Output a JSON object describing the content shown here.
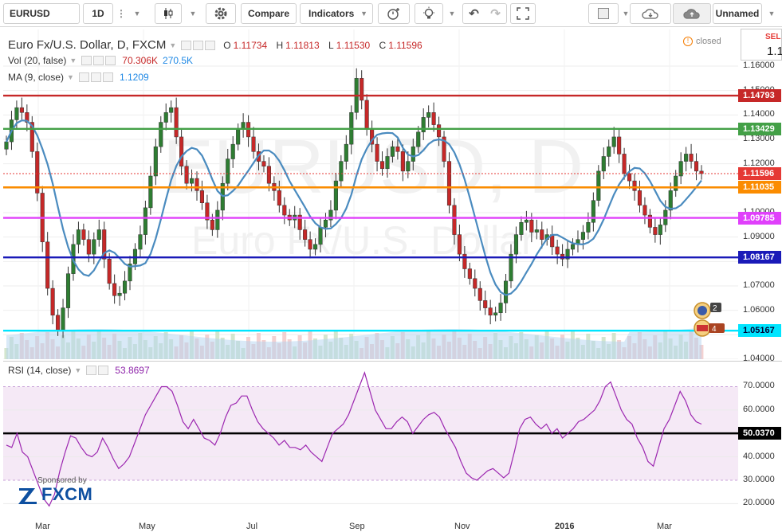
{
  "toolbar": {
    "symbol": "EURUSD",
    "interval": "1D",
    "compare": "Compare",
    "indicators": "Indicators",
    "layout_name": "Unnamed"
  },
  "main_legend": {
    "title": "Euro Fx/U.S. Dollar, D, FXCM",
    "o_label": "O",
    "o": "1.11734",
    "h_label": "H",
    "h": "1.11813",
    "l_label": "L",
    "l": "1.11530",
    "c_label": "C",
    "c": "1.11596",
    "vol_label": "Vol (20, false)",
    "vol_v1": "70.306K",
    "vol_v2": "270.5K",
    "ma_label": "MA (9, close)",
    "ma_v": "1.1209"
  },
  "status": {
    "closed": "closed"
  },
  "sell_panel": {
    "label": "SEL",
    "price": "1.1"
  },
  "watermark": {
    "line1": "EURUSD, D",
    "line2": "Euro Fx/U.S. Dollar"
  },
  "price_axis": {
    "ticks": [
      "1.15000",
      "1.16000",
      "1.14000",
      "1.13000",
      "1.12000",
      "1.10000",
      "1.09000",
      "1.08000",
      "1.07000",
      "1.06000",
      "1.04000"
    ],
    "levels": [
      {
        "label": "1.14793",
        "value": 1.14793,
        "color": "#c62828"
      },
      {
        "label": "1.13429",
        "value": 1.13429,
        "color": "#43a047"
      },
      {
        "label": "1.11035",
        "value": 1.11035,
        "color": "#fb8c00"
      },
      {
        "label": "1.09785",
        "value": 1.09785,
        "color": "#e040fb"
      },
      {
        "label": "1.08167",
        "value": 1.08167,
        "color": "#1a1ab8"
      },
      {
        "label": "1.05167",
        "value": 1.05167,
        "color": "#00e5ff"
      }
    ],
    "last_price": {
      "label": "1.11596",
      "value": 1.11596,
      "color": "#e53935"
    }
  },
  "rsi_legend": {
    "label": "RSI (14, close)",
    "value": "53.8697"
  },
  "rsi_axis": {
    "ticks": [
      "70.0000",
      "60.0000",
      "40.0000",
      "30.0000",
      "20.0000"
    ],
    "current": "50.0370"
  },
  "sponsor": {
    "label": "Sponsored by",
    "brand": "FXCM"
  },
  "badges": {
    "b1": "2",
    "b2": "4"
  },
  "time_axis": {
    "labels": [
      "Mar",
      "May",
      "Jul",
      "Sep",
      "Nov",
      "2016",
      "Mar"
    ]
  },
  "chart_data": {
    "type": "candlestick",
    "symbol": "EURUSD",
    "timeframe": "D",
    "close_series_approx": [
      1.129,
      1.138,
      1.143,
      1.141,
      1.137,
      1.125,
      1.108,
      1.088,
      1.069,
      1.058,
      1.052,
      1.061,
      1.075,
      1.087,
      1.093,
      1.089,
      1.083,
      1.089,
      1.093,
      1.081,
      1.071,
      1.066,
      1.067,
      1.072,
      1.079,
      1.085,
      1.091,
      1.102,
      1.115,
      1.127,
      1.137,
      1.141,
      1.143,
      1.131,
      1.119,
      1.112,
      1.114,
      1.109,
      1.104,
      1.097,
      1.093,
      1.101,
      1.112,
      1.122,
      1.128,
      1.134,
      1.137,
      1.131,
      1.125,
      1.121,
      1.119,
      1.112,
      1.109,
      1.103,
      1.099,
      1.097,
      1.099,
      1.093,
      1.089,
      1.085,
      1.087,
      1.094,
      1.097,
      1.101,
      1.113,
      1.121,
      1.128,
      1.141,
      1.155,
      1.146,
      1.134,
      1.128,
      1.121,
      1.118,
      1.123,
      1.127,
      1.125,
      1.117,
      1.121,
      1.127,
      1.133,
      1.139,
      1.141,
      1.136,
      1.131,
      1.121,
      1.103,
      1.091,
      1.083,
      1.077,
      1.073,
      1.069,
      1.064,
      1.061,
      1.058,
      1.059,
      1.063,
      1.072,
      1.083,
      1.091,
      1.096,
      1.097,
      1.092,
      1.093,
      1.089,
      1.091,
      1.086,
      1.083,
      1.081,
      1.085,
      1.087,
      1.089,
      1.092,
      1.096,
      1.105,
      1.117,
      1.123,
      1.127,
      1.131,
      1.124,
      1.116,
      1.113,
      1.109,
      1.103,
      1.099,
      1.094,
      1.091,
      1.095,
      1.101,
      1.109,
      1.115,
      1.121,
      1.124,
      1.121,
      1.117,
      1.116
    ],
    "ma_period": 9,
    "volume_pane": true,
    "horizontal_levels": [
      1.14793,
      1.13429,
      1.11035,
      1.09785,
      1.08167,
      1.05167
    ],
    "ylim": [
      1.04,
      1.175
    ],
    "rsi": {
      "period": 14,
      "ylim": [
        15,
        78
      ],
      "bands": [
        30,
        70
      ],
      "midline": 50.037,
      "values_approx": [
        45,
        44,
        50,
        42,
        40,
        34,
        28,
        22,
        19,
        24,
        34,
        42,
        49,
        48,
        44,
        41,
        40,
        42,
        48,
        44,
        39,
        35,
        37,
        40,
        46,
        52,
        58,
        62,
        66,
        70,
        70,
        68,
        62,
        55,
        52,
        56,
        52,
        48,
        47,
        45,
        50,
        57,
        62,
        63,
        66,
        66,
        60,
        55,
        52,
        50,
        48,
        45,
        47,
        44,
        44,
        43,
        45,
        42,
        40,
        38,
        44,
        50,
        52,
        54,
        58,
        64,
        70,
        76,
        68,
        60,
        56,
        52,
        52,
        55,
        57,
        55,
        50,
        53,
        56,
        58,
        59,
        57,
        52,
        48,
        44,
        38,
        33,
        31,
        30,
        32,
        34,
        35,
        33,
        31,
        33,
        42,
        52,
        56,
        57,
        54,
        52,
        54,
        50,
        52,
        48,
        50,
        52,
        55,
        56,
        58,
        60,
        64,
        70,
        72,
        66,
        60,
        56,
        54,
        48,
        44,
        38,
        36,
        44,
        52,
        56,
        62,
        68,
        64,
        58,
        55,
        54
      ]
    }
  }
}
